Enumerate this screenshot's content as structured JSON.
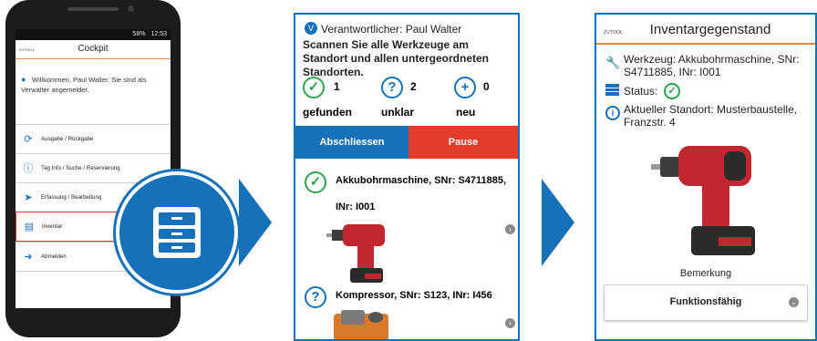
{
  "phone": {
    "status_time": "12:53",
    "status_battery": "58%",
    "brand": "ZVTOOL",
    "title": "Cockpit",
    "welcome": "Willkommen, Paul Walter. Sie sind als Verwalter angemeldet.",
    "menu": [
      {
        "label": "Ausgabe / Rückgabe",
        "icon": "refresh-icon"
      },
      {
        "label": "Tag Info / Suche / Reservierung",
        "icon": "info-icon"
      },
      {
        "label": "Erfassung / Bearbeitung",
        "icon": "tag-icon"
      },
      {
        "label": "Inventar",
        "icon": "drawer-icon"
      },
      {
        "label": "Abmelden",
        "icon": "logout-icon"
      }
    ]
  },
  "scan": {
    "responsible": "Verantwortlicher: Paul Walter",
    "instruction": "Scannen Sie alle Werkzeuge am Standort und allen untergeordneten Standorten.",
    "counts": [
      {
        "value": "1",
        "label": "gefunden"
      },
      {
        "value": "2",
        "label": "unklar"
      },
      {
        "value": "0",
        "label": "neu"
      }
    ],
    "btn_close": "Abschliessen",
    "btn_pause": "Pause",
    "items": [
      {
        "title": "Akkubohrmaschine, SNr: S4711885,",
        "sub": "INr: I001",
        "status": "check"
      },
      {
        "title": "Kompressor, SNr: S123, INr: I456",
        "status": "question"
      }
    ],
    "colors": {
      "blue": "#1572b9",
      "red": "#e53b2c",
      "green": "#2aa64a"
    }
  },
  "detail": {
    "brand": "ZVTOOL",
    "title": "Inventargegenstand",
    "tool": "Werkzeug: Akkubohrmaschine, SNr: S4711885, INr: I001",
    "status_label": "Status:",
    "location": "Aktueller Standort: Musterbaustelle, Franzstr. 4",
    "remark_label": "Bemerkung",
    "condition": "Funktionsfähig"
  }
}
